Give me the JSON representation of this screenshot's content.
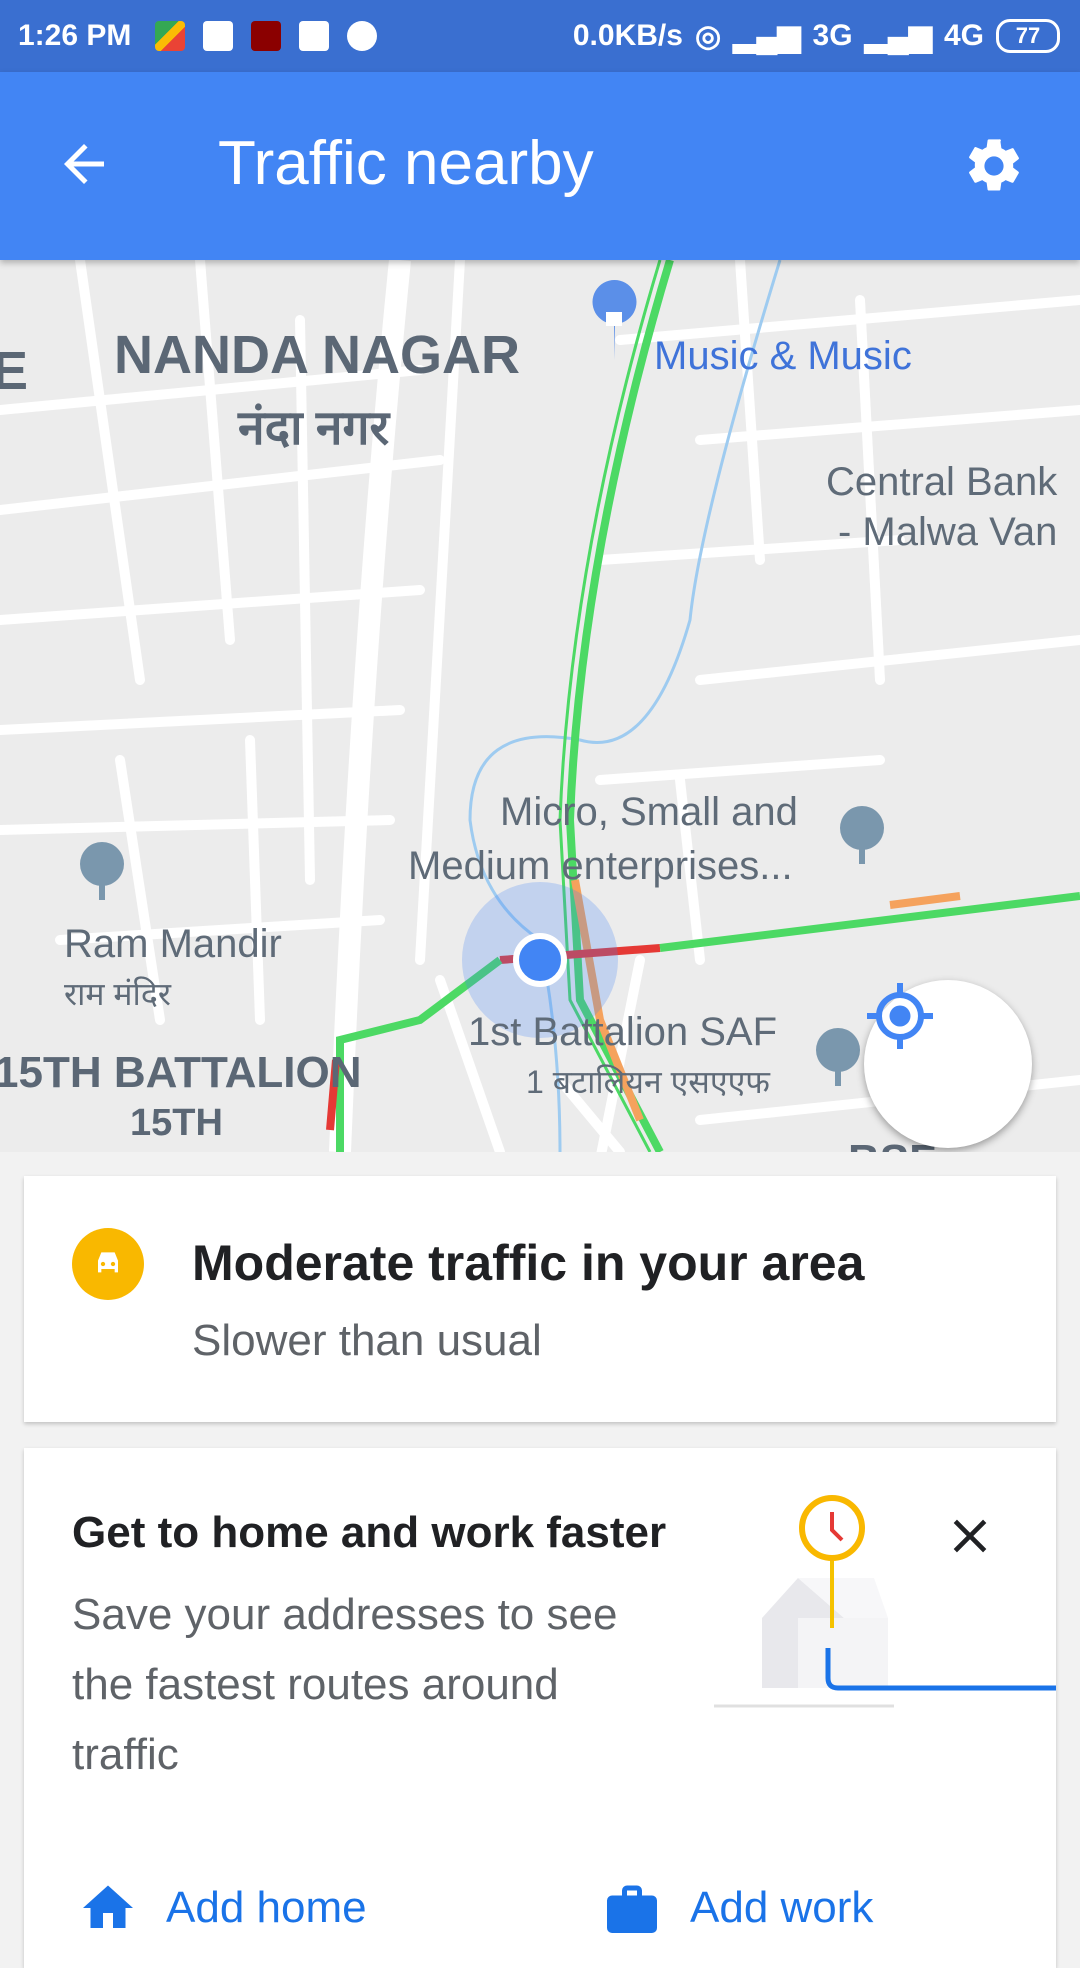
{
  "status_bar": {
    "time": "1:26 PM",
    "network_speed": "0.0KB/s",
    "signal_1": "3G",
    "signal_2": "4G",
    "battery": "77"
  },
  "app_bar": {
    "title": "Traffic nearby",
    "back_icon": "arrow-back-icon",
    "settings_icon": "gear-icon"
  },
  "map": {
    "labels": {
      "area_en": "NANDA NAGAR",
      "area_hi": "नंदा नगर",
      "poi_music": "Music & Music",
      "bank_line1": "Central Bank",
      "bank_line2": "- Malwa Van",
      "msme_line1": "Micro, Small and",
      "msme_line2": "Medium enterprises...",
      "ram_en": "Ram Mandir",
      "ram_hi": "राम मंदिर",
      "battalion_en": "1st Battalion SAF",
      "battalion_hi": "1 बटालियन एसएएफ",
      "area2_line1": "15TH BATTALION",
      "area2_line2": "15TH",
      "edge_left": "E",
      "bottom_cut": "BSF"
    },
    "traffic_colors": {
      "free": "#4cd964",
      "moderate": "#f5a25d",
      "heavy": "#e53935"
    },
    "my_location_icon": "my-location-icon",
    "go_label": "GO",
    "go_icon": "directions-icon"
  },
  "traffic_card": {
    "icon": "car-traffic-icon",
    "headline": "Moderate traffic in your area",
    "subtitle": "Slower than usual"
  },
  "promo_card": {
    "headline": "Get to home and work faster",
    "body": "Save your addresses to see the fastest routes around traffic",
    "close_icon": "close-icon",
    "add_home": "Add home",
    "add_work": "Add work"
  }
}
